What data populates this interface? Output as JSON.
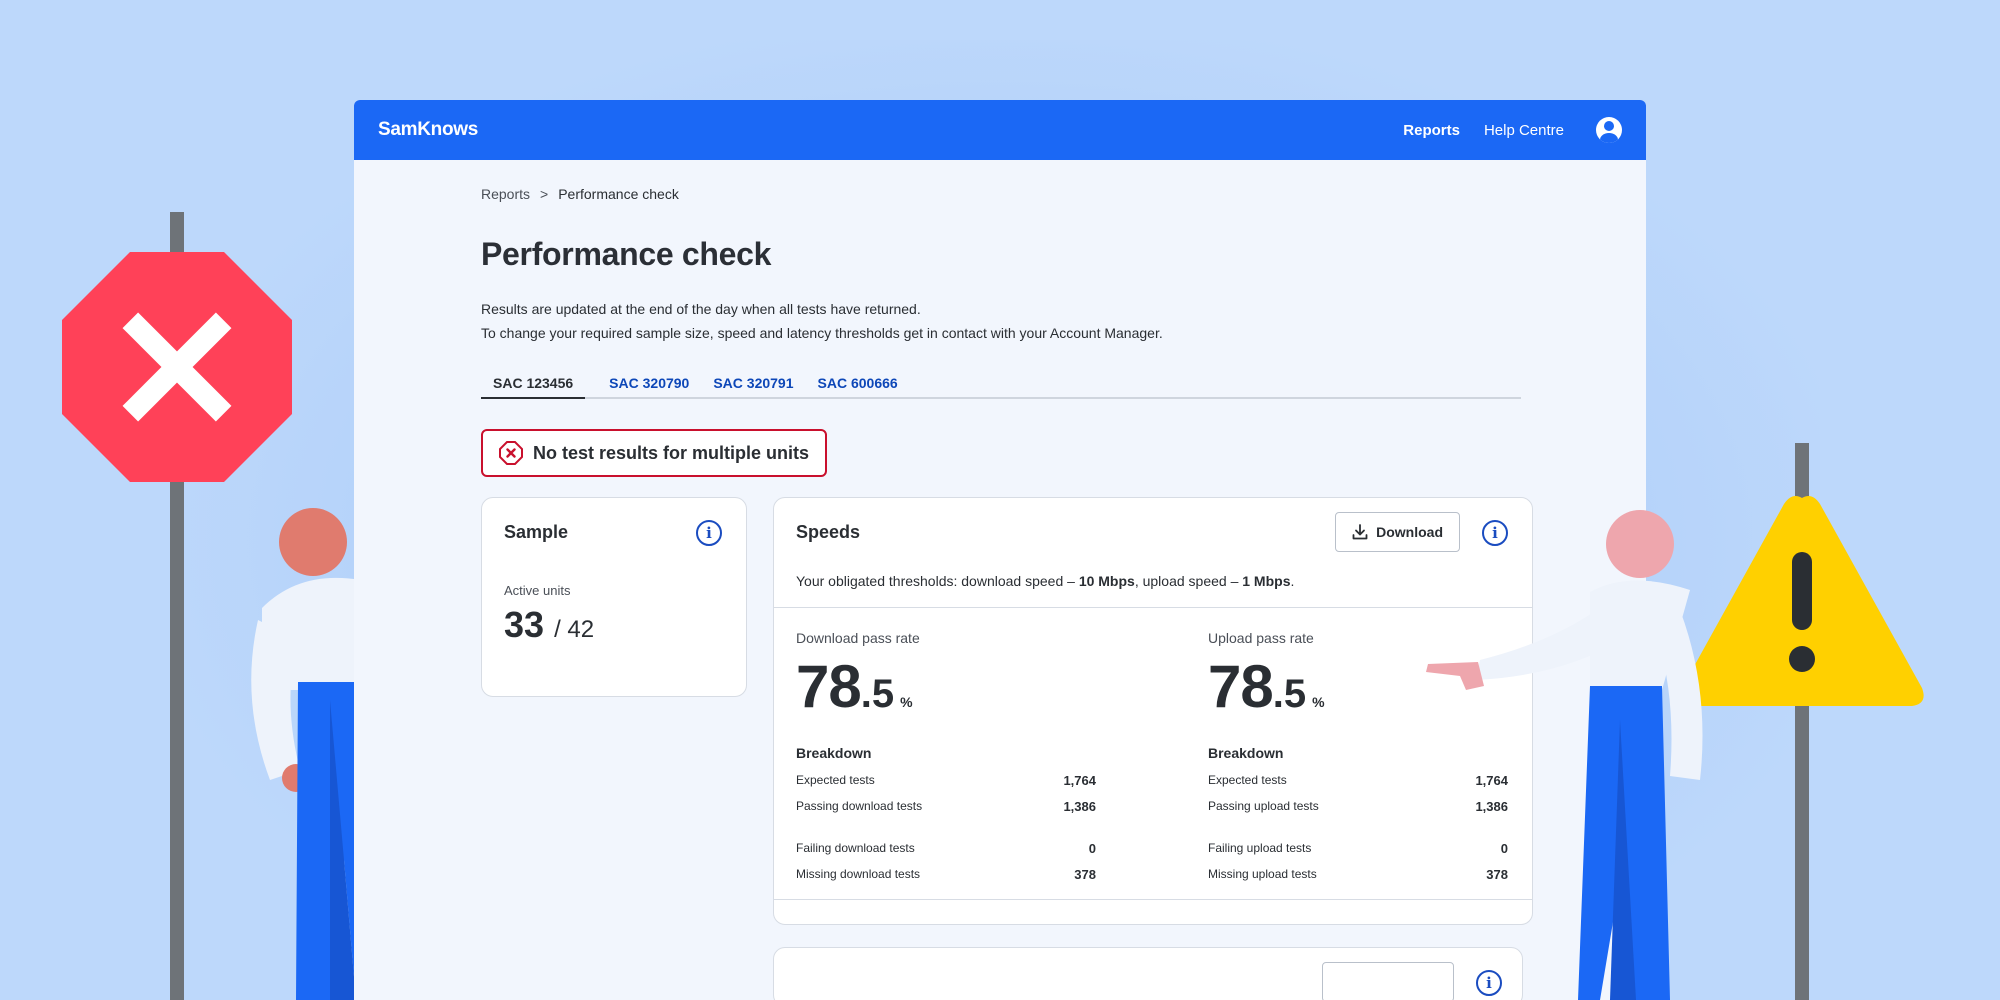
{
  "app": {
    "logo": "SamKnows",
    "nav": {
      "reports": "Reports",
      "help": "Help Centre"
    }
  },
  "breadcrumb": {
    "root": "Reports",
    "separator": ">",
    "current": "Performance check"
  },
  "page": {
    "title": "Performance check",
    "desc1": "Results are updated at the end of the day when all tests have returned.",
    "desc2": "To change your required sample size, speed and latency thresholds get in contact with your Account Manager."
  },
  "tabs": [
    "SAC 123456",
    "SAC 320790",
    "SAC 320791",
    "SAC 600666"
  ],
  "alert": {
    "text": "No test results for multiple units",
    "color": "#c9102d"
  },
  "sample": {
    "title": "Sample",
    "label": "Active units",
    "value": "33",
    "of": "/ 42"
  },
  "speeds": {
    "title": "Speeds",
    "download_label": "Download",
    "thresholds_prefix": "Your obligated thresholds: download speed – ",
    "download_threshold": "10 Mbps",
    "thresholds_mid": ", upload speed – ",
    "upload_threshold": "1 Mbps",
    "thresholds_suffix": ".",
    "download": {
      "label": "Download pass rate",
      "int": "78",
      "dec": ".5",
      "unit": "%",
      "breakdown_title": "Breakdown",
      "rows": [
        {
          "label": "Expected tests",
          "value": "1,764"
        },
        {
          "label": "Passing download tests",
          "value": "1,386"
        },
        {
          "label": "Failing download tests",
          "value": "0"
        },
        {
          "label": "Missing download tests",
          "value": "378"
        }
      ]
    },
    "upload": {
      "label": "Upload pass rate",
      "int": "78",
      "dec": ".5",
      "unit": "%",
      "breakdown_title": "Breakdown",
      "rows": [
        {
          "label": "Expected tests",
          "value": "1,764"
        },
        {
          "label": "Passing upload tests",
          "value": "1,386"
        },
        {
          "label": "Failing upload tests",
          "value": "0"
        },
        {
          "label": "Missing upload tests",
          "value": "378"
        }
      ]
    }
  },
  "colors": {
    "brand": "#1b68f5",
    "background": "#bdd8fb",
    "stop_sign": "#ff4158",
    "warning_sign": "#ffd000",
    "link": "#0d47b8"
  },
  "icons": {
    "error": "error-octagon-icon",
    "info": "info-icon",
    "download": "download-icon",
    "avatar": "user-avatar-icon"
  }
}
